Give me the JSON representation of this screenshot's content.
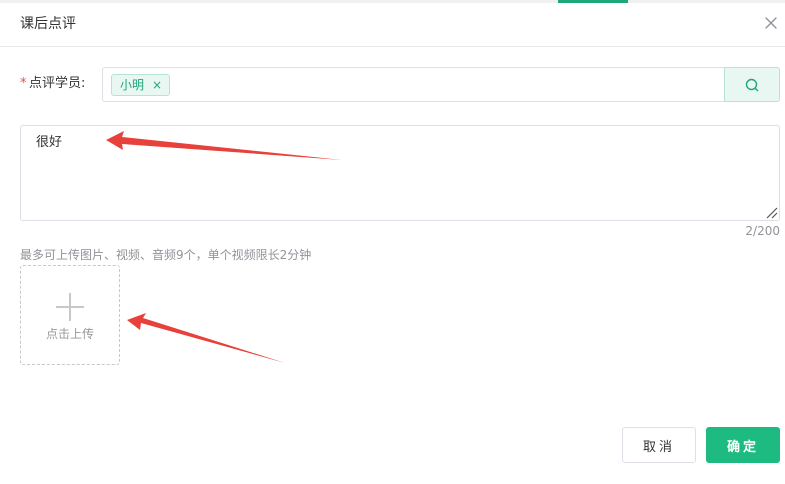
{
  "dialog": {
    "title": "课后点评",
    "close_icon": "close-icon"
  },
  "student_field": {
    "required_mark": "*",
    "label": "点评学员:",
    "selected_tag": "小明",
    "tag_remove_symbol": "×",
    "search_icon": "search-icon"
  },
  "comment": {
    "value": "很好",
    "counter": "2/200"
  },
  "upload": {
    "hint": "最多可上传图片、视频、音频9个，单个视频限长2分钟",
    "label": "点击上传",
    "icon": "plus-icon"
  },
  "footer": {
    "cancel_label": "取消",
    "confirm_label": "确定"
  },
  "colors": {
    "accent": "#1dbb82",
    "required": "#e84a4a",
    "annotation_arrow": "#e8403a"
  }
}
